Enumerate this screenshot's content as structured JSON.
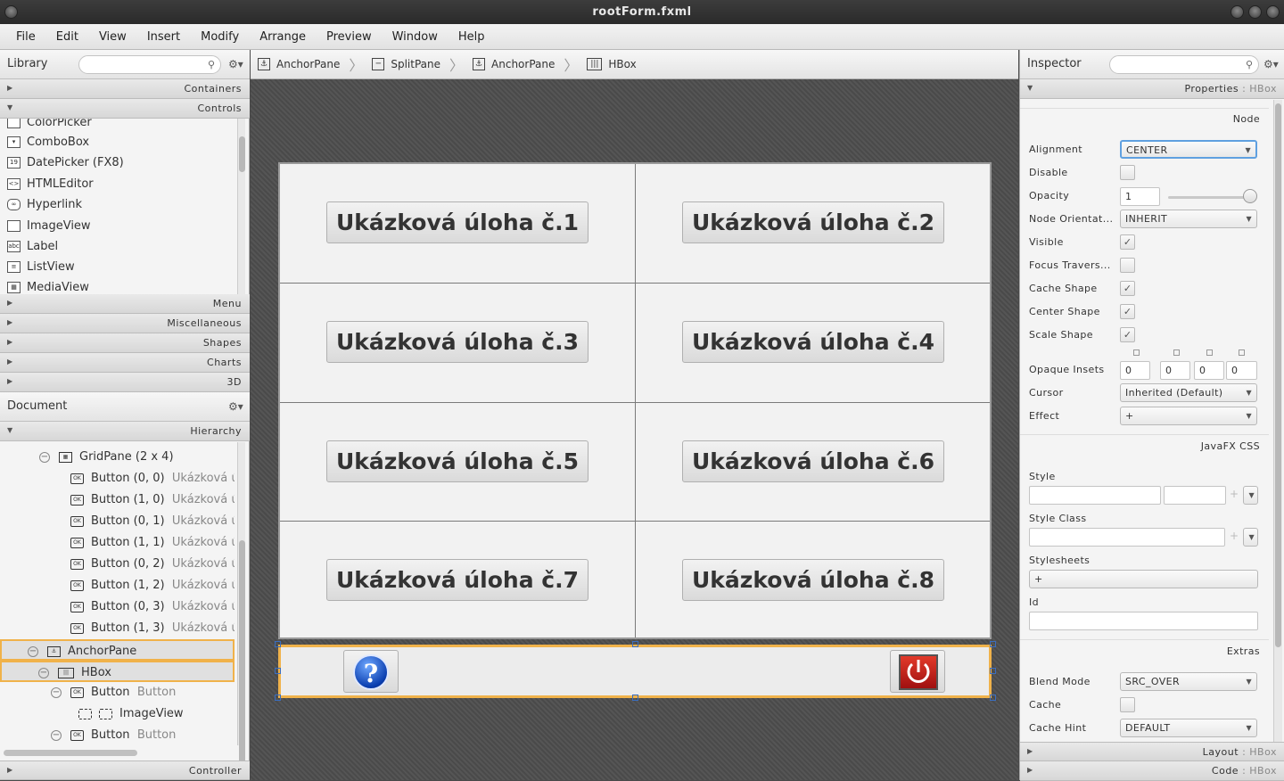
{
  "window": {
    "title": "rootForm.fxml"
  },
  "menu": [
    "File",
    "Edit",
    "View",
    "Insert",
    "Modify",
    "Arrange",
    "Preview",
    "Window",
    "Help"
  ],
  "library": {
    "title": "Library",
    "sections_top": [
      "Containers",
      "Controls"
    ],
    "controls": [
      "ColorPicker",
      "ComboBox",
      "DatePicker  (FX8)",
      "HTMLEditor",
      "Hyperlink",
      "ImageView",
      "Label",
      "ListView",
      "MediaView"
    ],
    "sections_bottom": [
      "Menu",
      "Miscellaneous",
      "Shapes",
      "Charts",
      "3D"
    ]
  },
  "document": {
    "title": "Document",
    "section": "Hierarchy",
    "tree": [
      {
        "label": "GridPane (2 x 4)",
        "extra": ""
      },
      {
        "label": "Button (0, 0)",
        "extra": "Ukázková ú"
      },
      {
        "label": "Button (1, 0)",
        "extra": "Ukázková ú"
      },
      {
        "label": "Button (0, 1)",
        "extra": "Ukázková ú"
      },
      {
        "label": "Button (1, 1)",
        "extra": "Ukázková ú"
      },
      {
        "label": "Button (0, 2)",
        "extra": "Ukázková ú"
      },
      {
        "label": "Button (1, 2)",
        "extra": "Ukázková ú"
      },
      {
        "label": "Button (0, 3)",
        "extra": "Ukázková ú"
      },
      {
        "label": "Button (1, 3)",
        "extra": "Ukázková ú"
      },
      {
        "label": "AnchorPane",
        "extra": ""
      },
      {
        "label": "HBox",
        "extra": ""
      },
      {
        "label": "Button",
        "extra": "Button"
      },
      {
        "label": "ImageView",
        "extra": ""
      },
      {
        "label": "Button",
        "extra": "Button"
      }
    ],
    "footer": "Controller"
  },
  "breadcrumb": [
    "AnchorPane",
    "SplitPane",
    "AnchorPane",
    "HBox"
  ],
  "canvas": {
    "buttons": [
      "Ukázková úloha č.1",
      "Ukázková úloha č.2",
      "Ukázková úloha č.3",
      "Ukázková úloha č.4",
      "Ukázková úloha č.5",
      "Ukázková úloha č.6",
      "Ukázková úloha č.7",
      "Ukázková úloha č.8"
    ],
    "help_glyph": "?"
  },
  "inspector": {
    "title": "Inspector",
    "properties_label": "Properties",
    "properties_target": ": HBox",
    "node": "Node",
    "alignment": {
      "label": "Alignment",
      "value": "CENTER"
    },
    "disable": "Disable",
    "opacity": {
      "label": "Opacity",
      "value": "1"
    },
    "orientation": {
      "label": "Node Orientat...",
      "value": "INHERIT"
    },
    "visible": "Visible",
    "focus": "Focus Travers...",
    "cache_shape": "Cache Shape",
    "center_shape": "Center Shape",
    "scale_shape": "Scale Shape",
    "opaque_insets": {
      "label": "Opaque Insets",
      "values": [
        "0",
        "0",
        "0",
        "0"
      ]
    },
    "cursor": {
      "label": "Cursor",
      "value": "Inherited (Default)"
    },
    "effect": {
      "label": "Effect",
      "value": "+"
    },
    "javafx_css": "JavaFX CSS",
    "style": "Style",
    "style_class": "Style Class",
    "stylesheets": "Stylesheets",
    "stylesheets_add": "+",
    "id": "Id",
    "extras": "Extras",
    "blend": {
      "label": "Blend Mode",
      "value": "SRC_OVER"
    },
    "cache": "Cache",
    "cache_hint": {
      "label": "Cache Hint",
      "value": "DEFAULT"
    },
    "layout": {
      "label": "Layout",
      "target": ": HBox"
    },
    "code": {
      "label": "Code",
      "target": ": HBox"
    }
  }
}
